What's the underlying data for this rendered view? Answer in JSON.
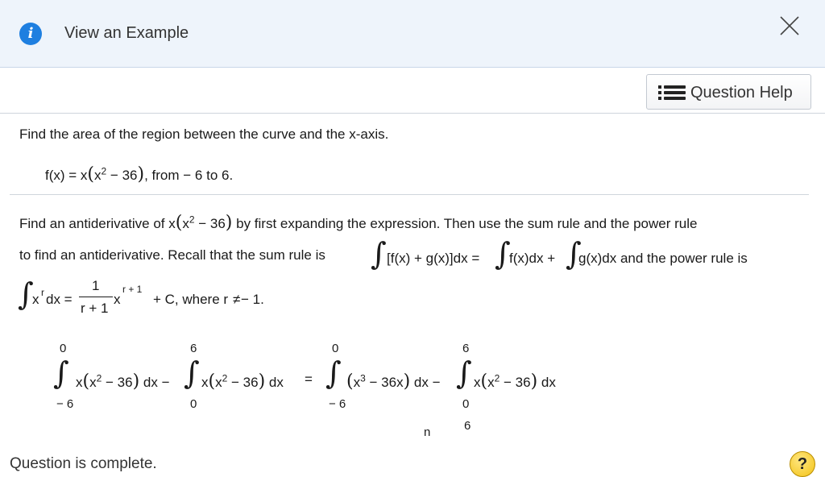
{
  "banner": {
    "view_example": "View an Example",
    "info_icon": "i"
  },
  "toolbar": {
    "question_help": "Question Help"
  },
  "problem": {
    "prompt": "Find the area of the region between the curve and the x-axis.",
    "f_lhs": "f(x) = x",
    "f_inner": "x",
    "f_exp": "2",
    "f_tail": " − 36",
    "f_range": ", from  − 6 to 6."
  },
  "instructions": {
    "line1_a": "Find an antiderivative of x",
    "line1_inner": "x",
    "line1_exp": "2",
    "line1_tail": " − 36",
    "line1_b": " by first expanding the expression. Then use the sum rule and the power rule",
    "line2_a": "to find an antiderivative. Recall that the sum rule is",
    "line2_sum": "[f(x) + g(x)]dx =",
    "line2_f": "f(x)dx +",
    "line2_g": "g(x)dx and the power rule is",
    "power_x": "x",
    "power_r": "r",
    "power_dx": "dx =",
    "power_num": "1",
    "power_den": "r + 1",
    "power_x2": "x",
    "power_exp2": "r + 1",
    "power_c": "+ C, where r",
    "power_neq": "≠",
    "power_tail": " − 1."
  },
  "work": {
    "i1_upper": "0",
    "i1_lower": "− 6",
    "i1_body_a": "x",
    "i1_body_b": "x",
    "i1_exp": "2",
    "i1_body_c": " − 36",
    "i1_dx": "dx −",
    "i2_upper": "6",
    "i2_lower": "0",
    "i2_body_a": "x",
    "i2_body_b": "x",
    "i2_exp": "2",
    "i2_body_c": " − 36",
    "i2_dx": "dx",
    "equals": "=",
    "i3_upper": "0",
    "i3_lower": "− 6",
    "i3_body_a": "x",
    "i3_exp": "3",
    "i3_body_b": " − 36x",
    "i3_dx": "dx −",
    "i4_upper": "6",
    "i4_lower": "0",
    "i4_body_a": "x",
    "i4_body_b": "x",
    "i4_exp": "2",
    "i4_body_c": " − 36",
    "i4_dx": "dx",
    "partial_upper": "n",
    "partial_lower": "6"
  },
  "footer": {
    "status": "Question is complete.",
    "help_symbol": "?"
  },
  "colors": {
    "accent": "#1e7fe0",
    "banner_bg": "#eef4fb",
    "help_yellow": "#f3c316"
  }
}
